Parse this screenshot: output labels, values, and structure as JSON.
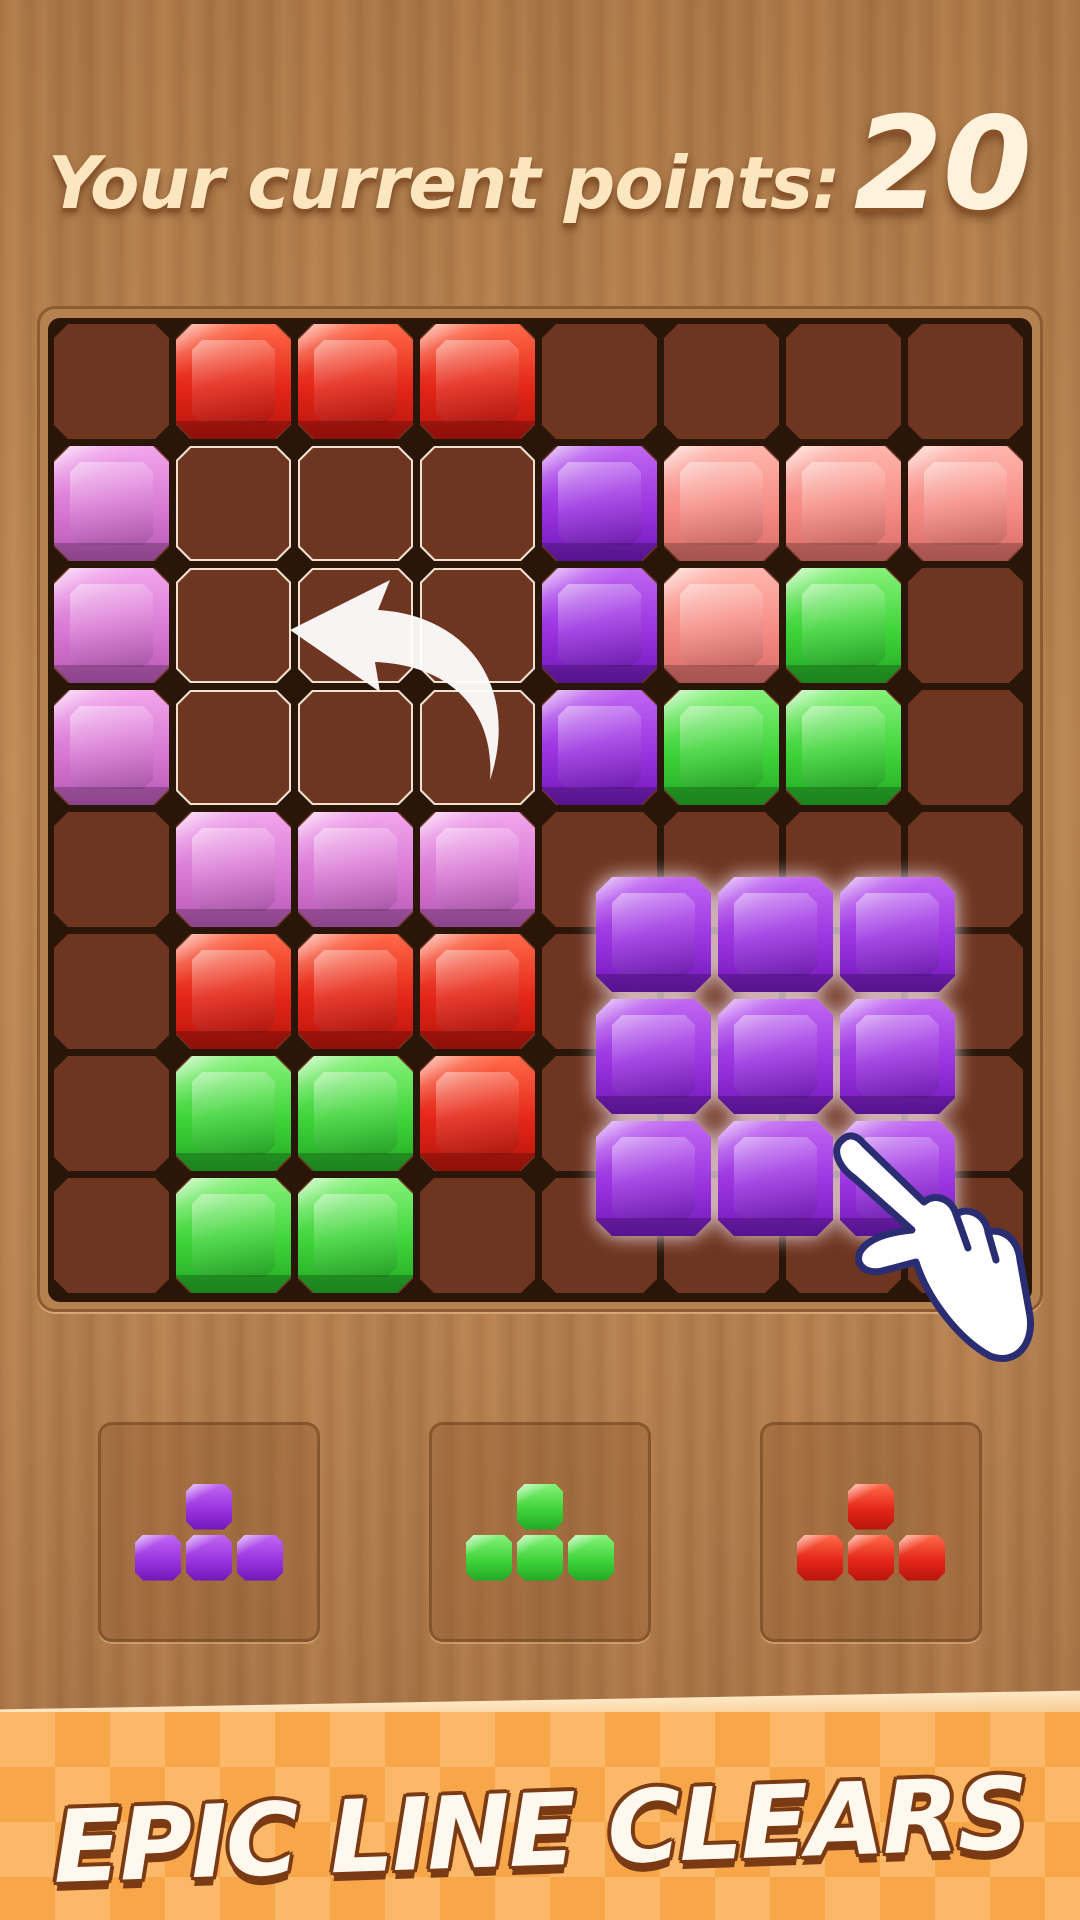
{
  "header": {
    "score_label": "Your current points:",
    "score_value": "20"
  },
  "colors": {
    "red": "#e42618",
    "pink": "#d879d4",
    "purple": "#9a34e0",
    "salmon": "#f58c85",
    "green": "#3fd43a",
    "board_cell": "#6e3520"
  },
  "board": {
    "size": 8,
    "rows": [
      [
        "",
        "red",
        "red",
        "red",
        "",
        "",
        "",
        ""
      ],
      [
        "pink",
        "",
        "",
        "",
        "purple",
        "salmon",
        "salmon",
        "salmon"
      ],
      [
        "pink",
        "",
        "",
        "",
        "purple",
        "salmon",
        "green",
        ""
      ],
      [
        "pink",
        "",
        "",
        "",
        "purple",
        "green",
        "green",
        ""
      ],
      [
        "",
        "pink",
        "pink",
        "pink",
        "",
        "",
        "",
        ""
      ],
      [
        "",
        "red",
        "red",
        "red",
        "",
        "",
        "",
        ""
      ],
      [
        "",
        "green",
        "green",
        "red",
        "",
        "",
        "",
        ""
      ],
      [
        "",
        "green",
        "green",
        "",
        "",
        "",
        "",
        ""
      ]
    ],
    "highlighted_empty": [
      [
        1,
        1
      ],
      [
        1,
        2
      ],
      [
        1,
        3
      ],
      [
        2,
        1
      ],
      [
        2,
        2
      ],
      [
        2,
        3
      ],
      [
        3,
        1
      ],
      [
        3,
        2
      ],
      [
        3,
        3
      ]
    ]
  },
  "dragging_piece": {
    "color": "purple",
    "shape": [
      [
        1,
        1,
        1
      ],
      [
        1,
        1,
        1
      ],
      [
        1,
        1,
        1
      ]
    ]
  },
  "pieces_tray": [
    {
      "color": "purple",
      "shape": [
        [
          0,
          1,
          0
        ],
        [
          1,
          1,
          1
        ]
      ]
    },
    {
      "color": "green",
      "shape": [
        [
          0,
          1,
          0
        ],
        [
          1,
          1,
          1
        ]
      ]
    },
    {
      "color": "red",
      "shape": [
        [
          0,
          1,
          0
        ],
        [
          1,
          1,
          1
        ]
      ]
    }
  ],
  "icons": {
    "arrow": "curved-arrow-icon",
    "hand": "pointing-hand-icon"
  },
  "banner": {
    "text": "EPIC LINE CLEARS"
  }
}
